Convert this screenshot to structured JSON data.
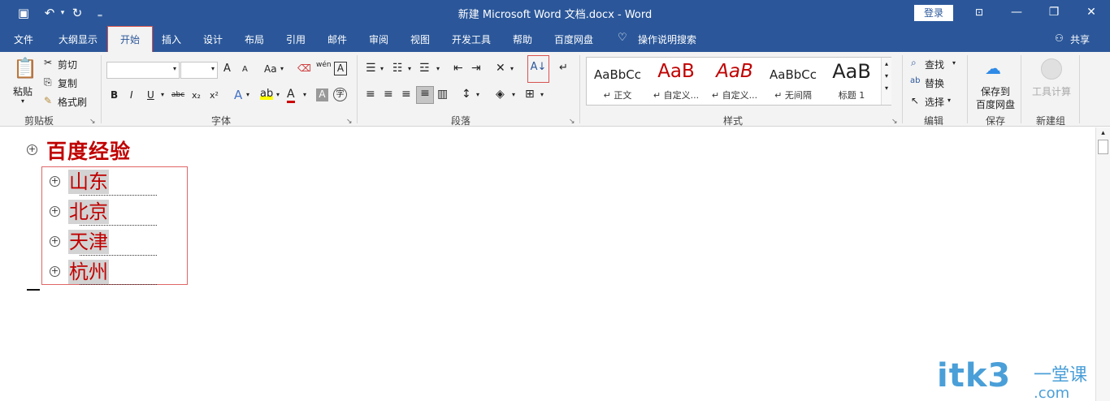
{
  "window": {
    "title": "新建 Microsoft Word 文档.docx  -  Word",
    "login_label": "登录",
    "share_label": "共享"
  },
  "tabs": [
    "文件",
    "大纲显示",
    "开始",
    "插入",
    "设计",
    "布局",
    "引用",
    "邮件",
    "审阅",
    "视图",
    "开发工具",
    "帮助",
    "百度网盘"
  ],
  "tell_me": "操作说明搜索",
  "clipboard": {
    "paste": "粘贴",
    "cut": "剪切",
    "copy": "复制",
    "format_painter": "格式刷",
    "group": "剪贴板"
  },
  "font": {
    "group": "字体",
    "family_value": "",
    "size_value": "",
    "bold": "B",
    "italic": "I",
    "underline": "U",
    "strike": "abc",
    "sub": "x₂",
    "sup": "x²",
    "grow": "A",
    "shrink": "A",
    "case": "Aa",
    "phonetic": "wén",
    "char_border": "A"
  },
  "paragraph": {
    "group": "段落"
  },
  "styles": {
    "group": "样式",
    "items": [
      {
        "sample": "AaBbCc",
        "name": "↵ 正文"
      },
      {
        "sample": "AaB",
        "name": "↵ 自定义..."
      },
      {
        "sample": "AaB",
        "name": "↵ 自定义..."
      },
      {
        "sample": "AaBbCc",
        "name": "↵ 无间隔"
      },
      {
        "sample": "AaB",
        "name": "标题 1"
      }
    ]
  },
  "editing": {
    "group": "编辑",
    "find": "查找",
    "replace": "替换",
    "select": "选择"
  },
  "save": {
    "group": "保存",
    "button_line1": "保存到",
    "button_line2": "百度网盘"
  },
  "newgroup": {
    "group": "新建组",
    "tool": "工具计算"
  },
  "document": {
    "heading": "百度经验",
    "items": [
      "山东",
      "北京",
      "天津",
      "杭州"
    ]
  },
  "watermark": {
    "main": "itk3",
    "sub": "一堂课",
    "domain": ".com"
  },
  "colors": {
    "accent": "#2b579a",
    "heading": "#c00000",
    "highlight_box": "#e06666"
  }
}
